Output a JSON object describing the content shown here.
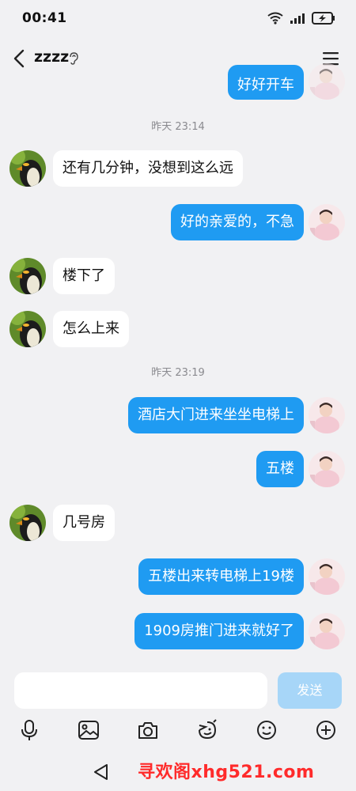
{
  "status": {
    "time": "00:41"
  },
  "header": {
    "title": "zzzz"
  },
  "messages": [
    {
      "text": "好好开车",
      "dir": "out"
    },
    {
      "timestamp": "昨天 23:14"
    },
    {
      "text": "还有几分钟，没想到这么远",
      "dir": "in"
    },
    {
      "text": "好的亲爱的，不急",
      "dir": "out"
    },
    {
      "text": "楼下了",
      "dir": "in"
    },
    {
      "text": "怎么上来",
      "dir": "in"
    },
    {
      "timestamp": "昨天 23:19"
    },
    {
      "text": "酒店大门进来坐坐电梯上",
      "dir": "out"
    },
    {
      "text": "五楼",
      "dir": "out"
    },
    {
      "text": "几号房",
      "dir": "in"
    },
    {
      "text": "五楼出来转电梯上19楼",
      "dir": "out"
    },
    {
      "text": "1909房推门进来就好了",
      "dir": "out"
    }
  ],
  "composer": {
    "placeholder": "",
    "send_label": "发送"
  },
  "toolbar": [
    "mic-icon",
    "image-icon",
    "camera-icon",
    "sticker-icon",
    "emoji-icon",
    "plus-icon"
  ],
  "watermark": "寻欢阁xhg521.com",
  "colors": {
    "outgoing_bubble": "#1f9bf2",
    "incoming_bubble": "#ffffff",
    "send_button": "#a7d6f8",
    "background": "#f1f1f3",
    "watermark": "#ff2b2b"
  }
}
